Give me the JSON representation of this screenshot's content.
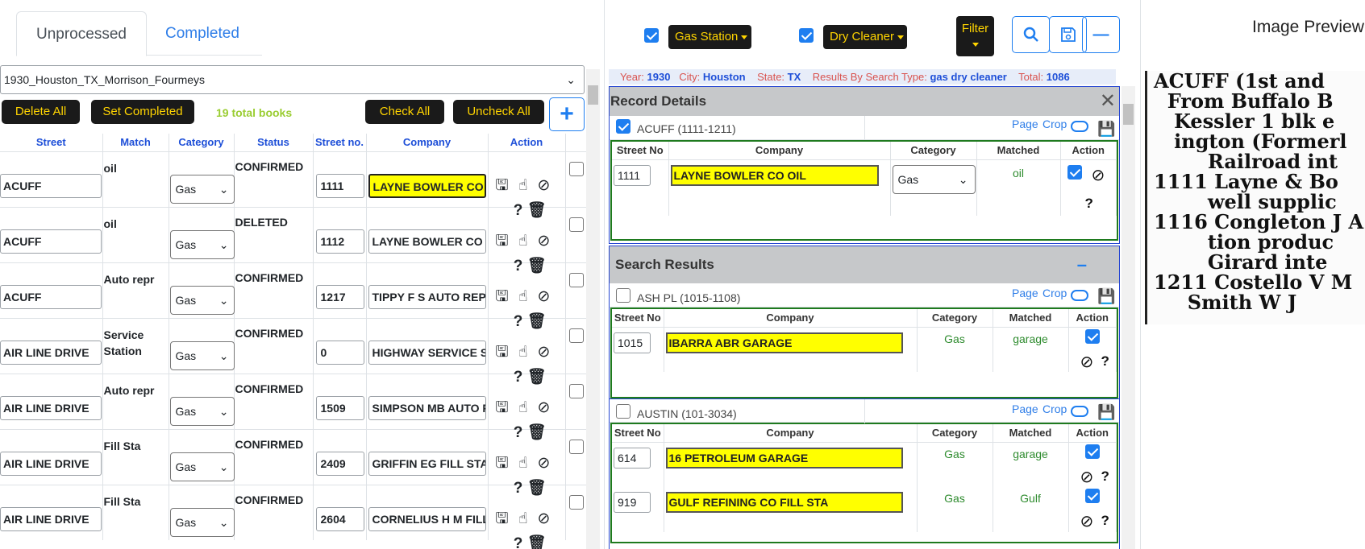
{
  "tabs": {
    "unprocessed": "Unprocessed",
    "completed": "Completed"
  },
  "book_select": "1930_Houston_TX_Morrison_Fourmeys",
  "toolbar": {
    "delete_all": "Delete All",
    "set_completed": "Set Completed",
    "total_books": "19 total books",
    "check_all": "Check All",
    "uncheck_all": "Uncheck All",
    "add": "+"
  },
  "grid": {
    "headers": [
      "Street",
      "Match",
      "Category",
      "Status",
      "Street no.",
      "Company",
      "Action"
    ],
    "rows": [
      {
        "street": "ACUFF",
        "match": "oil",
        "category": "Gas",
        "status": "CONFIRMED",
        "street_no": "1111",
        "company": "LAYNE BOWLER CO OIL",
        "highlight": true
      },
      {
        "street": "ACUFF",
        "match": "oil",
        "category": "Gas",
        "status": "DELETED",
        "street_no": "1112",
        "company": "LAYNE BOWLER CO OIL",
        "highlight": false
      },
      {
        "street": "ACUFF",
        "match": "Auto repr",
        "category": "Gas",
        "status": "CONFIRMED",
        "street_no": "1217",
        "company": "TIPPY F S AUTO REPR",
        "highlight": false
      },
      {
        "street": "AIR LINE DRIVE",
        "match": "Service Station",
        "category": "Gas",
        "status": "CONFIRMED",
        "street_no": "0",
        "company": "HIGHWAY SERVICE STA",
        "highlight": false
      },
      {
        "street": "AIR LINE DRIVE",
        "match": "Auto repr",
        "category": "Gas",
        "status": "CONFIRMED",
        "street_no": "1509",
        "company": "SIMPSON MB AUTO REPR",
        "highlight": false
      },
      {
        "street": "AIR LINE DRIVE",
        "match": "Fill Sta",
        "category": "Gas",
        "status": "CONFIRMED",
        "street_no": "2409",
        "company": "GRIFFIN EG FILL STA",
        "highlight": false
      },
      {
        "street": "AIR LINE DRIVE",
        "match": "Fill Sta",
        "category": "Gas",
        "status": "CONFIRMED",
        "street_no": "2604",
        "company": "CORNELIUS H M FILL STA",
        "highlight": false
      }
    ]
  },
  "filters": {
    "gas_station": "Gas Station",
    "dry_cleaner": "Dry Cleaner",
    "filter": "Filter"
  },
  "info": {
    "year_label": "Year:",
    "year": "1930",
    "city_label": "City:",
    "city": "Houston",
    "state_label": "State:",
    "state": "TX",
    "search_label": "Results By Search Type:",
    "search": "gas dry cleaner",
    "total_label": "Total:",
    "total": "1086"
  },
  "record": {
    "title": "Record Details",
    "street": "ACUFF (1111-1211)",
    "headers": [
      "Street No",
      "Company",
      "Category",
      "Matched",
      "Action"
    ],
    "street_no": "1111",
    "company": "LAYNE BOWLER CO OIL",
    "category": "Gas",
    "matched": "oil"
  },
  "links": {
    "page": "Page",
    "crop": "Crop"
  },
  "search": {
    "title": "Search Results",
    "groups": [
      {
        "street": "ASH PL (1015-1108)",
        "rows": [
          {
            "street_no": "1015",
            "company": "IBARRA ABR GARAGE",
            "category": "Gas",
            "matched": "garage"
          }
        ]
      },
      {
        "street": "AUSTIN (101-3034)",
        "rows": [
          {
            "street_no": "614",
            "company": "16 PETROLEUM GARAGE",
            "category": "Gas",
            "matched": "garage"
          },
          {
            "street_no": "919",
            "company": "GULF REFINING CO FILL STA",
            "category": "Gas",
            "matched": "Gulf"
          }
        ]
      }
    ]
  },
  "preview": {
    "title": "Image Preview",
    "scan_lines": [
      "ACUFF (1st and",
      "  From Buffalo B",
      "   Kessler 1 blk e",
      "   ington (Formerl",
      "        Railroad int",
      "1111 Layne & Bo",
      "        well supplic",
      "1116 Congleton J A",
      "        tion produc",
      "        Girard inte",
      "1211 Costello V M",
      "     Smith W J"
    ]
  }
}
